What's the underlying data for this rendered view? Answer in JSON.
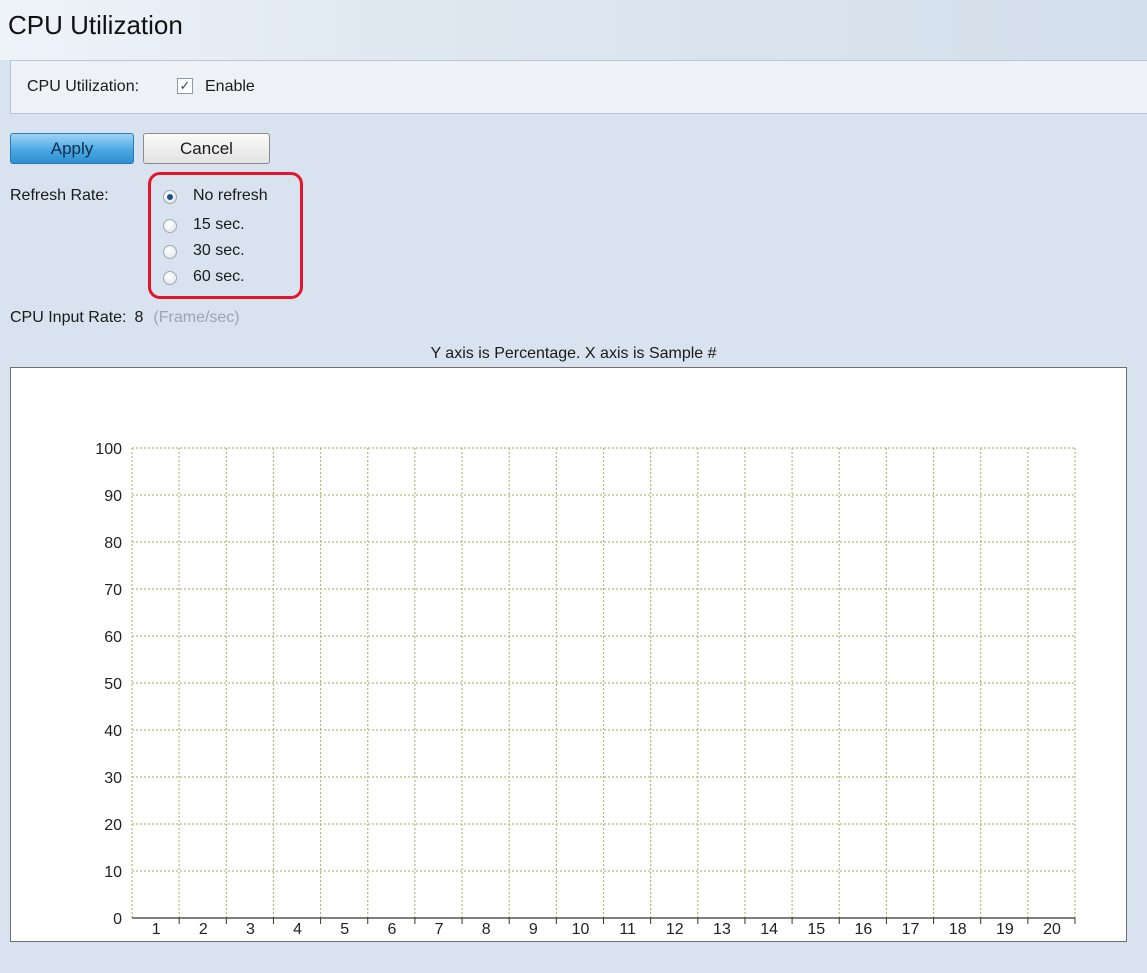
{
  "page": {
    "title": "CPU Utilization"
  },
  "settings": {
    "cpu_utilization_label": "CPU Utilization:",
    "enable_label": "Enable",
    "enable_checked": true
  },
  "buttons": {
    "apply": "Apply",
    "cancel": "Cancel"
  },
  "refresh": {
    "label": "Refresh Rate:",
    "options": [
      {
        "label": "No refresh",
        "checked": true
      },
      {
        "label": "15 sec.",
        "checked": false
      },
      {
        "label": "30 sec.",
        "checked": false
      },
      {
        "label": "60 sec.",
        "checked": false
      }
    ],
    "highlight_color": "#e3152b"
  },
  "input_rate": {
    "label": "CPU Input Rate:",
    "value": "8",
    "unit": "(Frame/sec)"
  },
  "chart_data": {
    "type": "line",
    "title": "Y axis is Percentage. X axis is Sample #",
    "x_ticks": [
      "1",
      "2",
      "3",
      "4",
      "5",
      "6",
      "7",
      "8",
      "9",
      "10",
      "11",
      "12",
      "13",
      "14",
      "15",
      "16",
      "17",
      "18",
      "19",
      "20"
    ],
    "y_ticks": [
      "0",
      "10",
      "20",
      "30",
      "40",
      "50",
      "60",
      "70",
      "80",
      "90",
      "100"
    ],
    "ylim": [
      0,
      100
    ],
    "xlim": [
      0,
      20
    ],
    "grid": true,
    "grid_color": "#b7b77a",
    "series": []
  }
}
